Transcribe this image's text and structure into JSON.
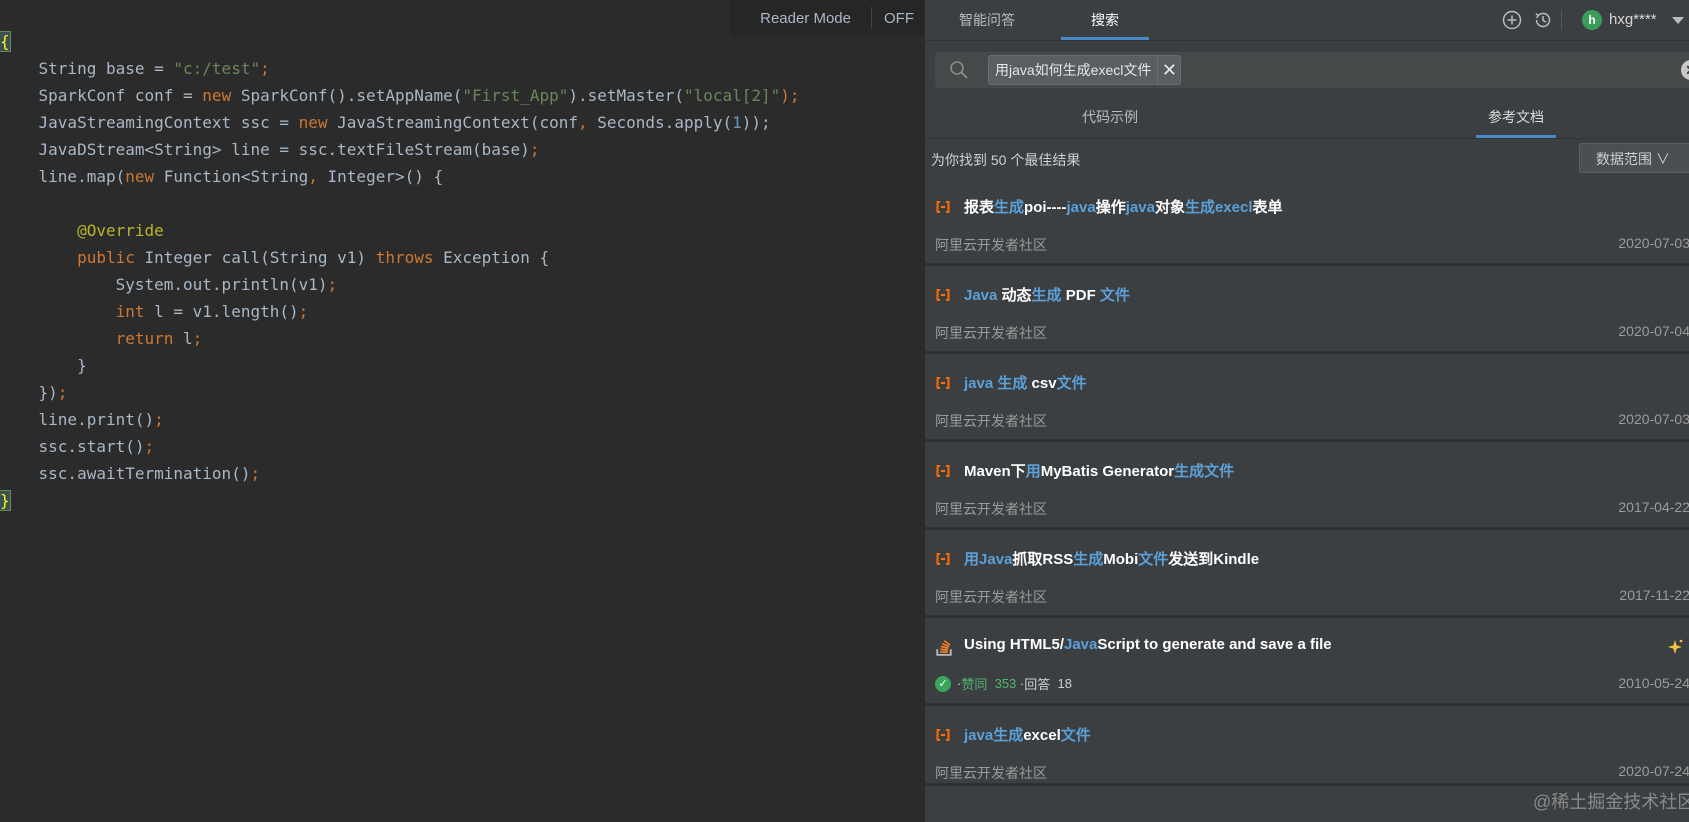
{
  "editor": {
    "reader_mode_label": "Reader Mode",
    "reader_mode_state": "OFF",
    "code_lines": [
      [
        {
          "t": "{",
          "c": "brace"
        }
      ],
      [
        {
          "t": "    String base = ",
          "c": "t"
        },
        {
          "t": "\"c:/test\"",
          "c": "str"
        },
        {
          "t": ";",
          "c": "p"
        }
      ],
      [
        {
          "t": "    SparkConf conf = ",
          "c": "t"
        },
        {
          "t": "new ",
          "c": "kw"
        },
        {
          "t": "SparkConf().setAppName(",
          "c": "t"
        },
        {
          "t": "\"First_App\"",
          "c": "str"
        },
        {
          "t": ").setMaster(",
          "c": "t"
        },
        {
          "t": "\"local[2]\"",
          "c": "str"
        },
        {
          "t": ");",
          "c": "p"
        }
      ],
      [
        {
          "t": "    JavaStreamingContext ssc = ",
          "c": "t"
        },
        {
          "t": "new ",
          "c": "kw"
        },
        {
          "t": "JavaStreamingContext(conf",
          "c": "t"
        },
        {
          "t": ", ",
          "c": "p"
        },
        {
          "t": "Seconds.apply(",
          "c": "t"
        },
        {
          "t": "1",
          "c": "num"
        },
        {
          "t": "));",
          "c": "t"
        }
      ],
      [
        {
          "t": "    JavaDStream<String> line = ssc.textFileStream(base)",
          "c": "t"
        },
        {
          "t": ";",
          "c": "p"
        }
      ],
      [
        {
          "t": "    line.map(",
          "c": "t"
        },
        {
          "t": "new ",
          "c": "kw"
        },
        {
          "t": "Function<String",
          "c": "t"
        },
        {
          "t": ", ",
          "c": "p"
        },
        {
          "t": "Integer>() {",
          "c": "t"
        }
      ],
      [
        {
          "t": "",
          "c": "t"
        }
      ],
      [
        {
          "t": "        @Override",
          "c": "ann"
        }
      ],
      [
        {
          "t": "        ",
          "c": "t"
        },
        {
          "t": "public ",
          "c": "kw"
        },
        {
          "t": "Integer call(String v1) ",
          "c": "t"
        },
        {
          "t": "throws ",
          "c": "kw"
        },
        {
          "t": "Exception {",
          "c": "t"
        }
      ],
      [
        {
          "t": "            System.out.println(v1)",
          "c": "t"
        },
        {
          "t": ";",
          "c": "p"
        }
      ],
      [
        {
          "t": "            ",
          "c": "t"
        },
        {
          "t": "int ",
          "c": "kw"
        },
        {
          "t": "l = v1.length()",
          "c": "t"
        },
        {
          "t": ";",
          "c": "p"
        }
      ],
      [
        {
          "t": "            ",
          "c": "t"
        },
        {
          "t": "return ",
          "c": "kw"
        },
        {
          "t": "l",
          "c": "t"
        },
        {
          "t": ";",
          "c": "p"
        }
      ],
      [
        {
          "t": "        }",
          "c": "t"
        }
      ],
      [
        {
          "t": "    })",
          "c": "t"
        },
        {
          "t": ";",
          "c": "p"
        }
      ],
      [
        {
          "t": "    line.print()",
          "c": "t"
        },
        {
          "t": ";",
          "c": "p"
        }
      ],
      [
        {
          "t": "    ssc.start()",
          "c": "t"
        },
        {
          "t": ";",
          "c": "p"
        }
      ],
      [
        {
          "t": "    ssc.awaitTermination()",
          "c": "t"
        },
        {
          "t": ";",
          "c": "p"
        }
      ],
      [
        {
          "t": "}",
          "c": "brace"
        }
      ]
    ]
  },
  "panel": {
    "tabs": [
      "智能问答",
      "搜索"
    ],
    "active_tab": "搜索",
    "username": "hxg****",
    "avatar_letter": "h",
    "search_query": "用java如何生成execl文件",
    "sub_tabs": [
      "代码示例",
      "参考文档"
    ],
    "active_sub_tab": "参考文档",
    "result_count": "为你找到 50 个最佳结果",
    "range_button": "数据范围  ∨",
    "results": [
      {
        "icon": "aliyun-icon",
        "title": [
          {
            "t": "报表",
            "h": false
          },
          {
            "t": "生成",
            "h": true
          },
          {
            "t": "poi----",
            "h": false
          },
          {
            "t": "java",
            "h": true
          },
          {
            "t": "操作",
            "h": false
          },
          {
            "t": "java",
            "h": true
          },
          {
            "t": "对象",
            "h": false
          },
          {
            "t": "生成",
            "h": true
          },
          {
            "t": "execl",
            "h": true
          },
          {
            "t": "表单",
            "h": false
          }
        ],
        "source": "阿里云开发者社区",
        "date": "2020-07-03"
      },
      {
        "icon": "aliyun-icon",
        "title": [
          {
            "t": "Java",
            "h": true
          },
          {
            "t": " 动态",
            "h": false
          },
          {
            "t": "生成",
            "h": true
          },
          {
            "t": " PDF ",
            "h": false
          },
          {
            "t": "文件",
            "h": true
          }
        ],
        "source": "阿里云开发者社区",
        "date": "2020-07-04"
      },
      {
        "icon": "aliyun-icon",
        "title": [
          {
            "t": "java ",
            "h": true
          },
          {
            "t": "生成",
            "h": true
          },
          {
            "t": " csv",
            "h": false
          },
          {
            "t": "文件",
            "h": true
          }
        ],
        "source": "阿里云开发者社区",
        "date": "2020-07-03"
      },
      {
        "icon": "aliyun-icon",
        "title": [
          {
            "t": "Maven下",
            "h": false
          },
          {
            "t": "用",
            "h": true
          },
          {
            "t": "MyBatis Generator",
            "h": false
          },
          {
            "t": "生成",
            "h": true
          },
          {
            "t": "文件",
            "h": true
          }
        ],
        "source": "阿里云开发者社区",
        "date": "2017-04-22"
      },
      {
        "icon": "aliyun-icon",
        "title": [
          {
            "t": "用",
            "h": true
          },
          {
            "t": "Java",
            "h": true
          },
          {
            "t": "抓取RSS",
            "h": false
          },
          {
            "t": "生成",
            "h": true
          },
          {
            "t": "Mobi",
            "h": false
          },
          {
            "t": "文件",
            "h": true
          },
          {
            "t": "发送到Kindle",
            "h": false
          }
        ],
        "source": "阿里云开发者社区",
        "date": "2017-11-22"
      },
      {
        "icon": "stackoverflow-icon",
        "title": [
          {
            "t": "Using HTML5/",
            "h": false
          },
          {
            "t": "Java",
            "h": true
          },
          {
            "t": "Script to generate and save a file",
            "h": false
          }
        ],
        "meta": {
          "votes_label": "赞同",
          "votes": "353",
          "answers_label": "回答",
          "answers": "18"
        },
        "date": "2010-05-24"
      },
      {
        "icon": "aliyun-icon",
        "title": [
          {
            "t": "java",
            "h": true
          },
          {
            "t": "生成",
            "h": true
          },
          {
            "t": "excel",
            "h": false
          },
          {
            "t": "文件",
            "h": true
          }
        ],
        "source": "阿里云开发者社区",
        "date": "2020-07-24"
      }
    ],
    "watermark": "@稀土掘金技术社区"
  }
}
